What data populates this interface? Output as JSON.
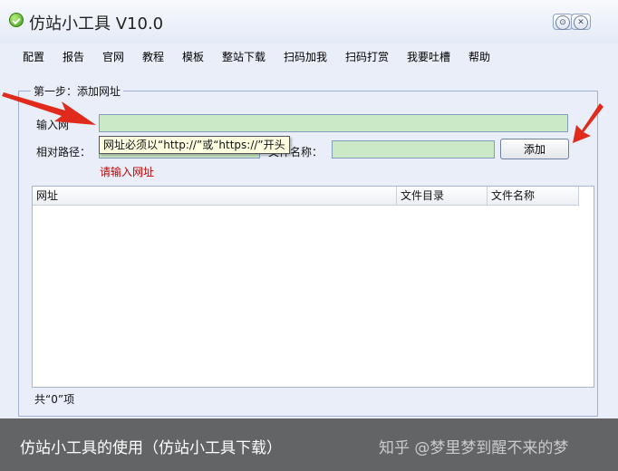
{
  "window": {
    "title": "仿站小工具 V10.0"
  },
  "controls": {
    "minimize_glyph": "⊙",
    "close_glyph": "✕"
  },
  "menu": [
    "配置",
    "报告",
    "官网",
    "教程",
    "模板",
    "整站下载",
    "扫码加我",
    "扫码打赏",
    "我要吐槽",
    "帮助"
  ],
  "step1": {
    "label": "第一步：添加网址",
    "url_label": "输入网",
    "url_value": "",
    "relpath_label": "相对路径：",
    "relpath_value": "",
    "filename_label": "文件名称：",
    "filename_value": "",
    "add_button": "添加",
    "tooltip": "网址必须以“http://”或“https://”开头",
    "error": "请输入网址"
  },
  "table": {
    "columns": [
      "网址",
      "文件目录",
      "文件名称"
    ],
    "rows": []
  },
  "status": {
    "count_text": "共“0”项"
  },
  "caption": {
    "text": "仿站小工具的使用（仿站小工具下载）",
    "watermark": "知乎 @梦里梦到醒不来的梦"
  },
  "colors": {
    "field_bg": "#cbe9c7",
    "error": "#cc0000",
    "arrow": "#e02a1c",
    "window_bg": "#e9eef8"
  }
}
